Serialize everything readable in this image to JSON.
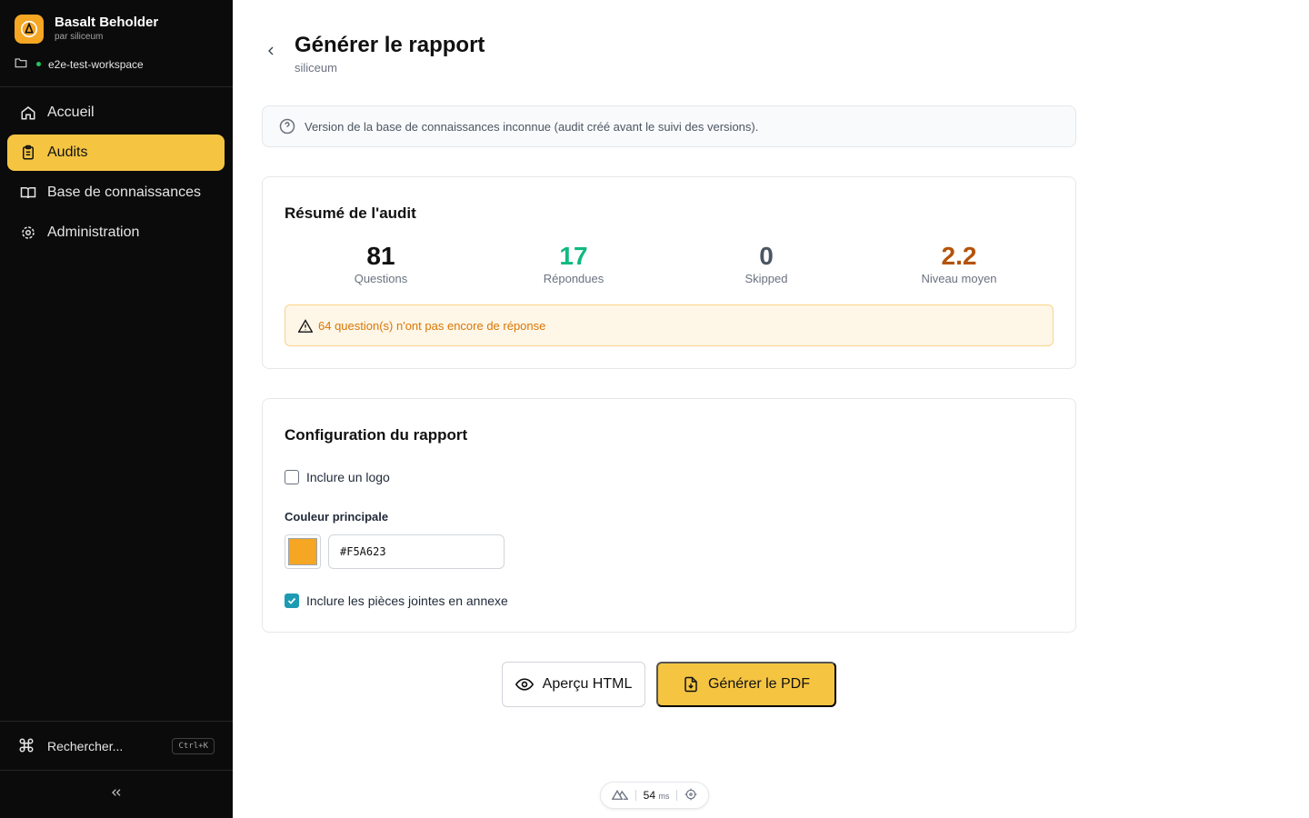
{
  "brand": {
    "name": "Basalt Beholder",
    "by": "par siliceum"
  },
  "workspace": {
    "name": "e2e-test-workspace"
  },
  "nav": {
    "items": [
      {
        "label": "Accueil",
        "icon": "home-icon"
      },
      {
        "label": "Audits",
        "icon": "clipboard-icon",
        "active": true
      },
      {
        "label": "Base de connaissances",
        "icon": "book-icon"
      },
      {
        "label": "Administration",
        "icon": "gear-icon"
      }
    ]
  },
  "search": {
    "label": "Rechercher...",
    "shortcut": "Ctrl+K"
  },
  "page": {
    "title": "Générer le rapport",
    "subtitle": "siliceum"
  },
  "info": {
    "text": "Version de la base de connaissances inconnue (audit créé avant le suivi des versions)."
  },
  "summary": {
    "title": "Résumé de l'audit",
    "stats": [
      {
        "value": "81",
        "label": "Questions",
        "color": "#111111"
      },
      {
        "value": "17",
        "label": "Répondues",
        "color": "#10b981"
      },
      {
        "value": "0",
        "label": "Skipped",
        "color": "#4b5563"
      },
      {
        "value": "2.2",
        "label": "Niveau moyen",
        "color": "#b45309"
      }
    ],
    "warning": "64 question(s) n'ont pas encore de réponse"
  },
  "config": {
    "title": "Configuration du rapport",
    "include_logo": {
      "label": "Inclure un logo",
      "checked": false
    },
    "color_label": "Couleur principale",
    "color_value": "#F5A623",
    "include_attachments": {
      "label": "Inclure les pièces jointes en annexe",
      "checked": true
    }
  },
  "actions": {
    "preview": "Aperçu HTML",
    "generate": "Générer le PDF"
  },
  "perf": {
    "value": "54",
    "unit": "ms"
  },
  "colors": {
    "accent": "#f5c542",
    "sidebar": "#0b0b0b",
    "check": "#1d9bb3"
  }
}
